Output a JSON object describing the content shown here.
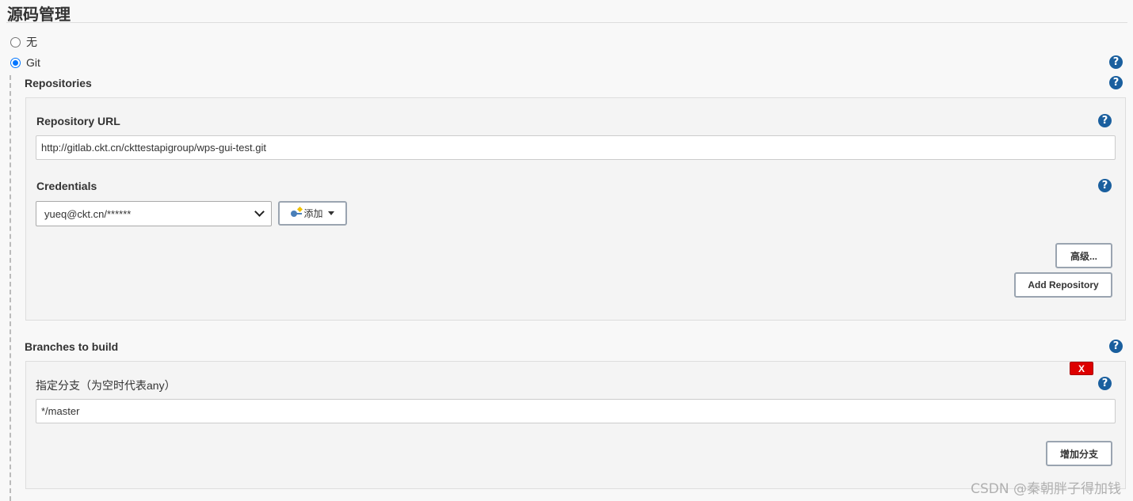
{
  "section": {
    "title": "源码管理"
  },
  "scm_options": [
    {
      "label": "无",
      "checked": false
    },
    {
      "label": "Git",
      "checked": true
    }
  ],
  "repositories": {
    "label": "Repositories",
    "url_label": "Repository URL",
    "url_value": "http://gitlab.ckt.cn/ckttestapigroup/wps-gui-test.git",
    "credentials_label": "Credentials",
    "credentials_selected": "yueq@ckt.cn/******",
    "add_label": "添加",
    "advanced_label": "高级...",
    "add_repository_label": "Add Repository"
  },
  "branches": {
    "label": "Branches to build",
    "delete_label": "X",
    "specifier_label": "指定分支（为空时代表any）",
    "specifier_value": "*/master",
    "add_branch_label": "增加分支"
  },
  "help_symbol": "?",
  "watermark": "CSDN @秦朝胖子得加钱",
  "colors": {
    "help": "#1a5f9e",
    "radio": "#0075ff",
    "delete": "#dd0000"
  }
}
